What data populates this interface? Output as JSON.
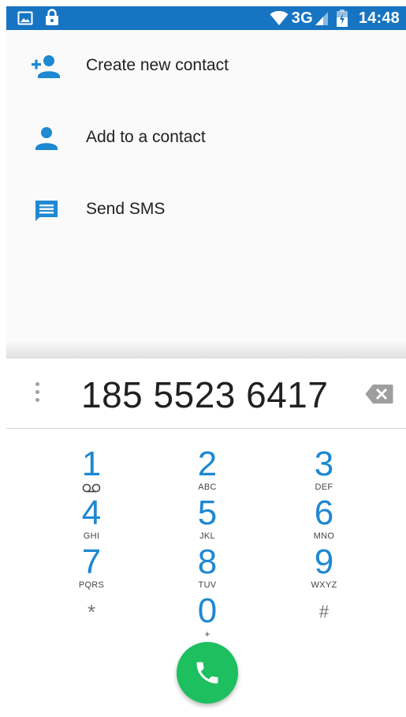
{
  "status_bar": {
    "network": "3G",
    "time": "14:48",
    "background_color": "#1774c2",
    "left_icons": [
      "image-icon",
      "lock-icon"
    ],
    "right_icons": [
      "wifi-icon",
      "signal-icon",
      "battery-icon"
    ]
  },
  "actions": [
    {
      "label": "Create new contact",
      "icon": "add-person-icon"
    },
    {
      "label": "Add to a contact",
      "icon": "person-icon"
    },
    {
      "label": "Send SMS",
      "icon": "message-icon"
    }
  ],
  "dialer": {
    "number": "185 5523 6417",
    "overflow_icon": "more-vertical-icon",
    "backspace_icon": "backspace-icon",
    "accent_color": "#1e88d2",
    "call_color": "#1dbf5f",
    "call_icon": "phone-icon",
    "keys": [
      {
        "digit": "1",
        "letters": "",
        "extra_icon": "voicemail-icon"
      },
      {
        "digit": "2",
        "letters": "ABC"
      },
      {
        "digit": "3",
        "letters": "DEF"
      },
      {
        "digit": "4",
        "letters": "GHI"
      },
      {
        "digit": "5",
        "letters": "JKL"
      },
      {
        "digit": "6",
        "letters": "MNO"
      },
      {
        "digit": "7",
        "letters": "PQRS"
      },
      {
        "digit": "8",
        "letters": "TUV"
      },
      {
        "digit": "9",
        "letters": "WXYZ"
      },
      {
        "digit": "*",
        "letters": ""
      },
      {
        "digit": "0",
        "letters": "+"
      },
      {
        "digit": "#",
        "letters": ""
      }
    ]
  }
}
